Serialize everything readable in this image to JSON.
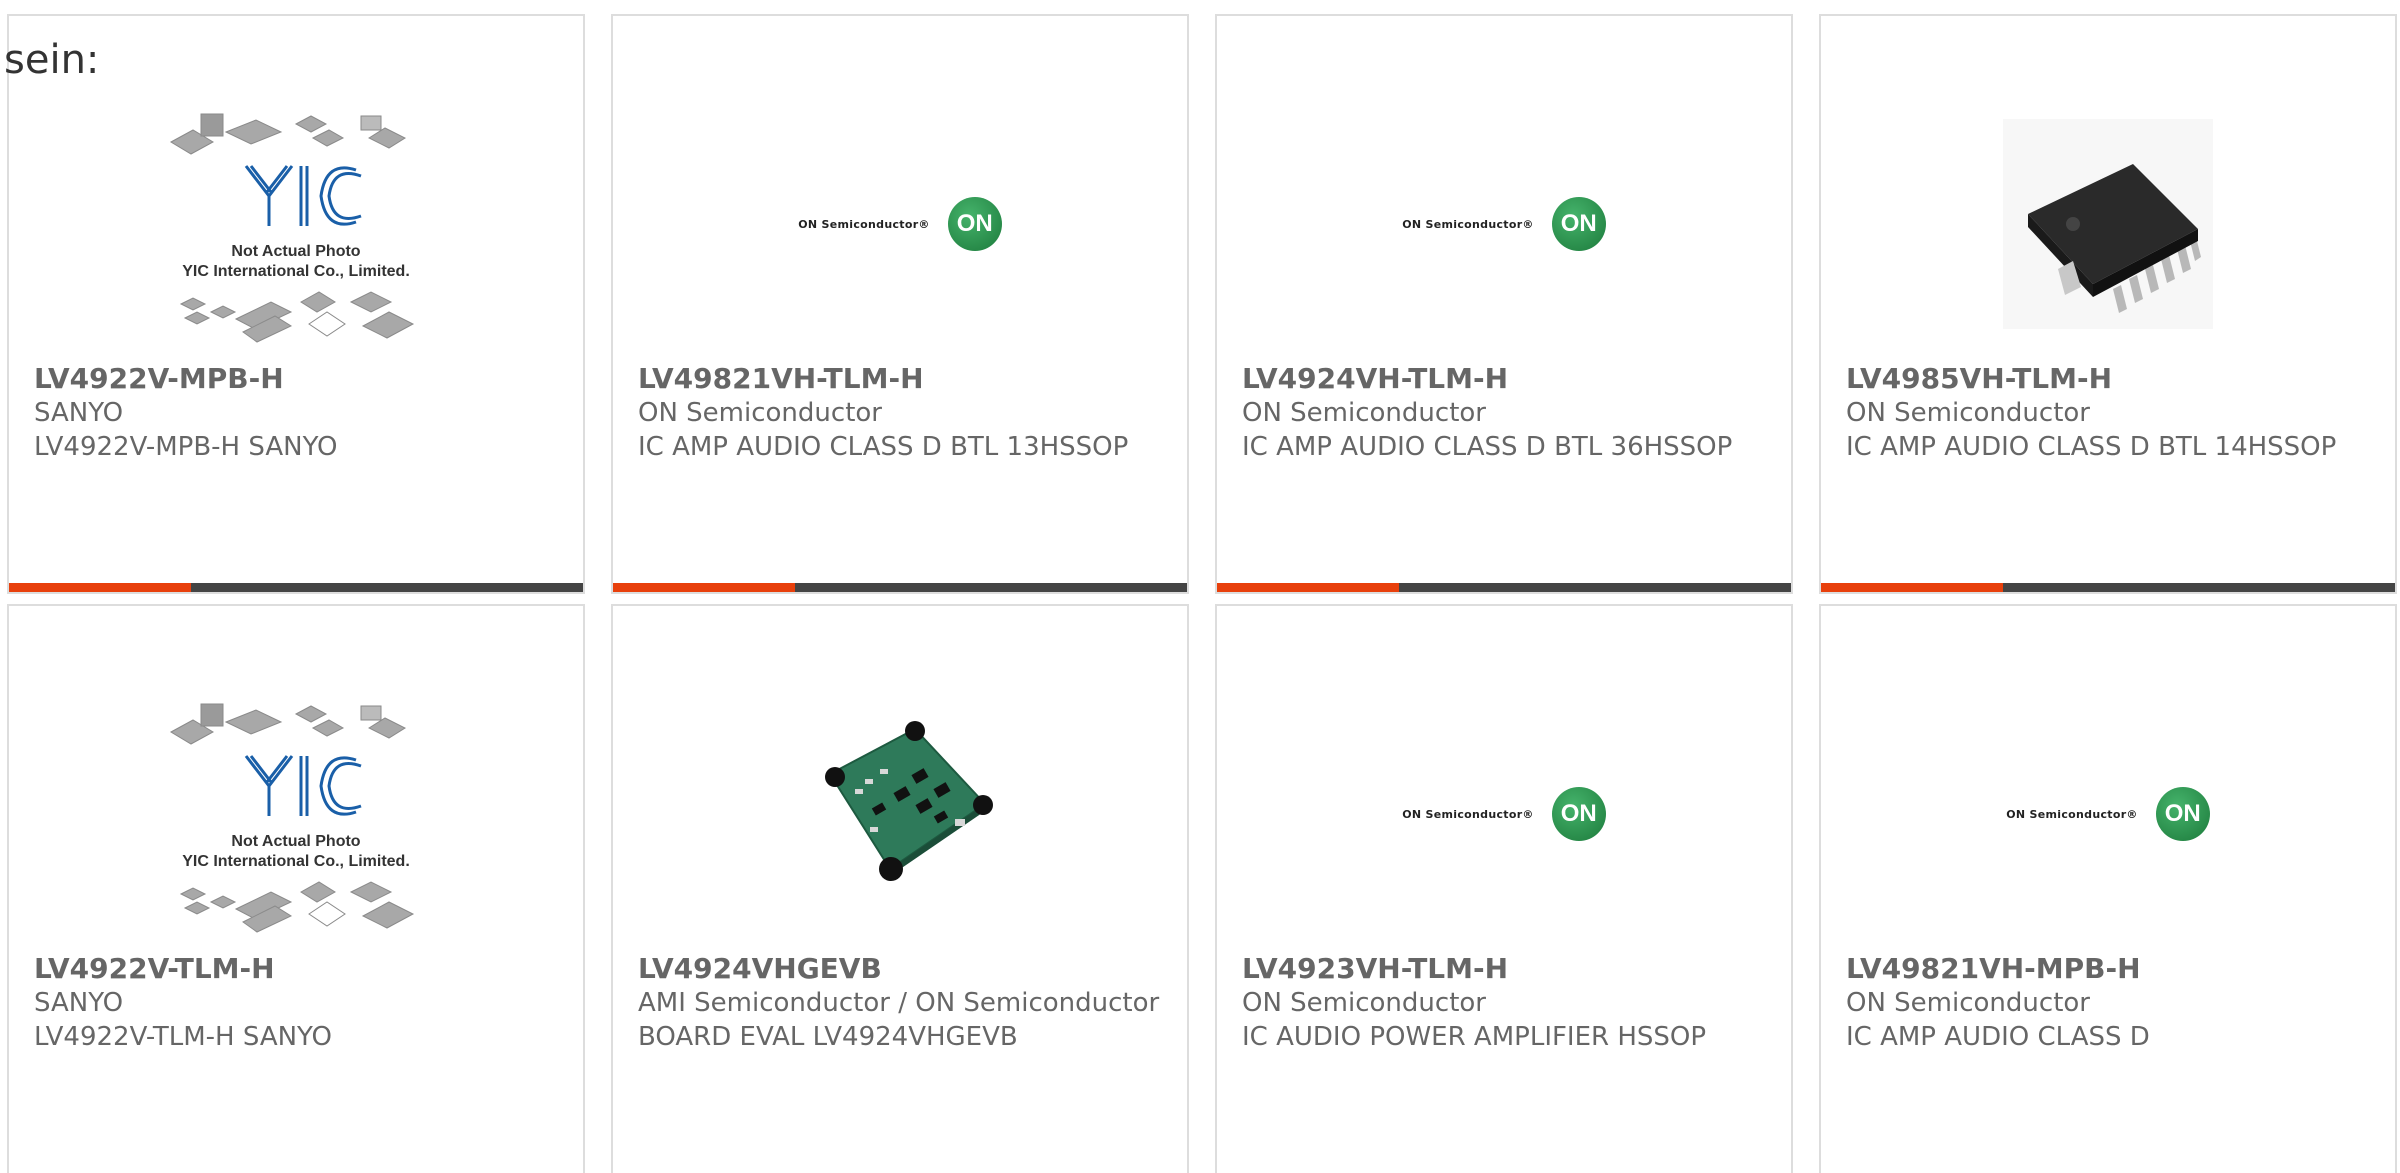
{
  "intro_text": "sein:",
  "cards": [
    {
      "part": "LV4922V-MPB-H",
      "manufacturer": "SANYO",
      "description": "LV4922V-MPB-H SANYO",
      "image": "not-actual-photo",
      "placeholder_line1": "Not Actual Photo",
      "placeholder_line2": "YIC International Co., Limited."
    },
    {
      "part": "LV49821VH-TLM-H",
      "manufacturer": "ON Semiconductor",
      "description": "IC AMP AUDIO CLASS D BTL 13HSSOP",
      "image": "on-semi-logo",
      "logo_text": "ON Semiconductor®",
      "logo_mark": "ON"
    },
    {
      "part": "LV4924VH-TLM-H",
      "manufacturer": "ON Semiconductor",
      "description": "IC AMP AUDIO CLASS D BTL 36HSSOP",
      "image": "on-semi-logo",
      "logo_text": "ON Semiconductor®",
      "logo_mark": "ON"
    },
    {
      "part": "LV4985VH-TLM-H",
      "manufacturer": "ON Semiconductor",
      "description": "IC AMP AUDIO CLASS D BTL 14HSSOP",
      "image": "ic-chip-photo"
    },
    {
      "part": "LV4922V-TLM-H",
      "manufacturer": "SANYO",
      "description": "LV4922V-TLM-H SANYO",
      "image": "not-actual-photo",
      "placeholder_line1": "Not Actual Photo",
      "placeholder_line2": "YIC International Co., Limited."
    },
    {
      "part": "LV4924VHGEVB",
      "manufacturer": "AMI Semiconductor / ON Semiconductor",
      "description": "BOARD EVAL LV4924VHGEVB",
      "image": "eval-board-photo"
    },
    {
      "part": "LV4923VH-TLM-H",
      "manufacturer": "ON Semiconductor",
      "description": "IC AUDIO POWER AMPLIFIER HSSOP",
      "image": "on-semi-logo",
      "logo_text": "ON Semiconductor®",
      "logo_mark": "ON"
    },
    {
      "part": "LV49821VH-MPB-H",
      "manufacturer": "ON Semiconductor",
      "description": "IC AMP AUDIO CLASS D",
      "image": "on-semi-logo",
      "logo_text": "ON Semiconductor®",
      "logo_mark": "ON"
    }
  ],
  "colors": {
    "accent": "#e8400c",
    "bar": "#444444",
    "text": "#666666",
    "on_green": "#1c7a3b"
  }
}
